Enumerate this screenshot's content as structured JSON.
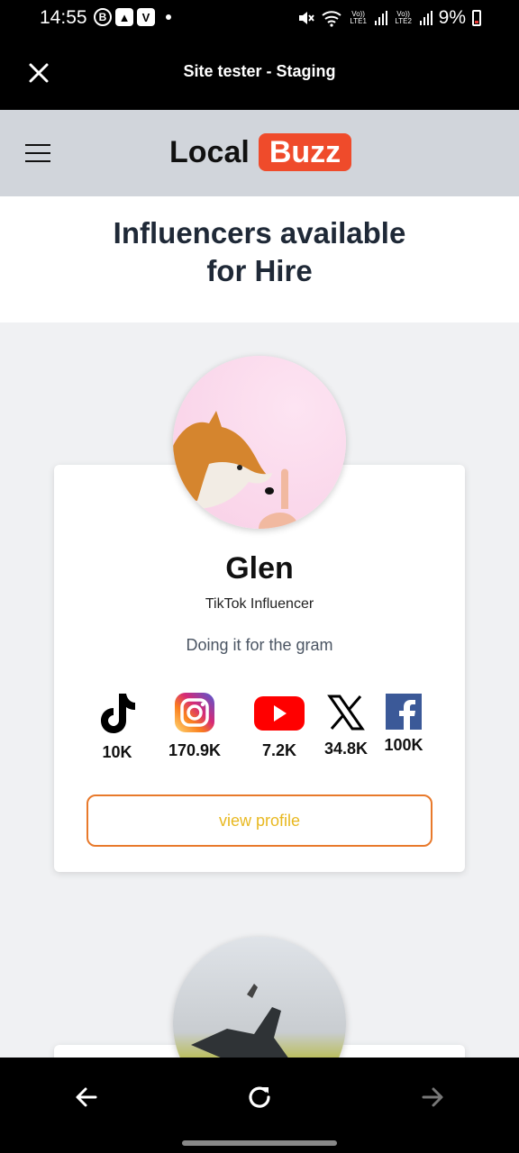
{
  "status_bar": {
    "time": "14:55",
    "left_icons": [
      "B",
      "▲",
      "V"
    ],
    "lte1": "Vo)) LTE1",
    "lte2": "Vo)) LTE2",
    "battery": "9%"
  },
  "app_header": {
    "title": "Site tester - Staging"
  },
  "site": {
    "logo_part1": "Local",
    "logo_part2": "Buzz",
    "page_title_line1": "Influencers available",
    "page_title_line2": "for Hire"
  },
  "influencers": [
    {
      "name": "Glen",
      "role": "TikTok Influencer",
      "bio": "Doing it for the gram",
      "socials": [
        {
          "platform": "tiktok",
          "icon": "tiktok-icon",
          "count": "10K"
        },
        {
          "platform": "instagram",
          "icon": "instagram-icon",
          "count": "170.9K"
        },
        {
          "platform": "youtube",
          "icon": "youtube-icon",
          "count": "7.2K"
        },
        {
          "platform": "x",
          "icon": "x-icon",
          "count": "34.8K"
        },
        {
          "platform": "facebook",
          "icon": "facebook-icon",
          "count": "100K"
        }
      ],
      "button_label": "view profile"
    }
  ],
  "colors": {
    "logo_accent": "#ef4b2b",
    "button_border": "#e8792b",
    "button_text": "#e8b820",
    "nav_background": "#d1d5db"
  }
}
